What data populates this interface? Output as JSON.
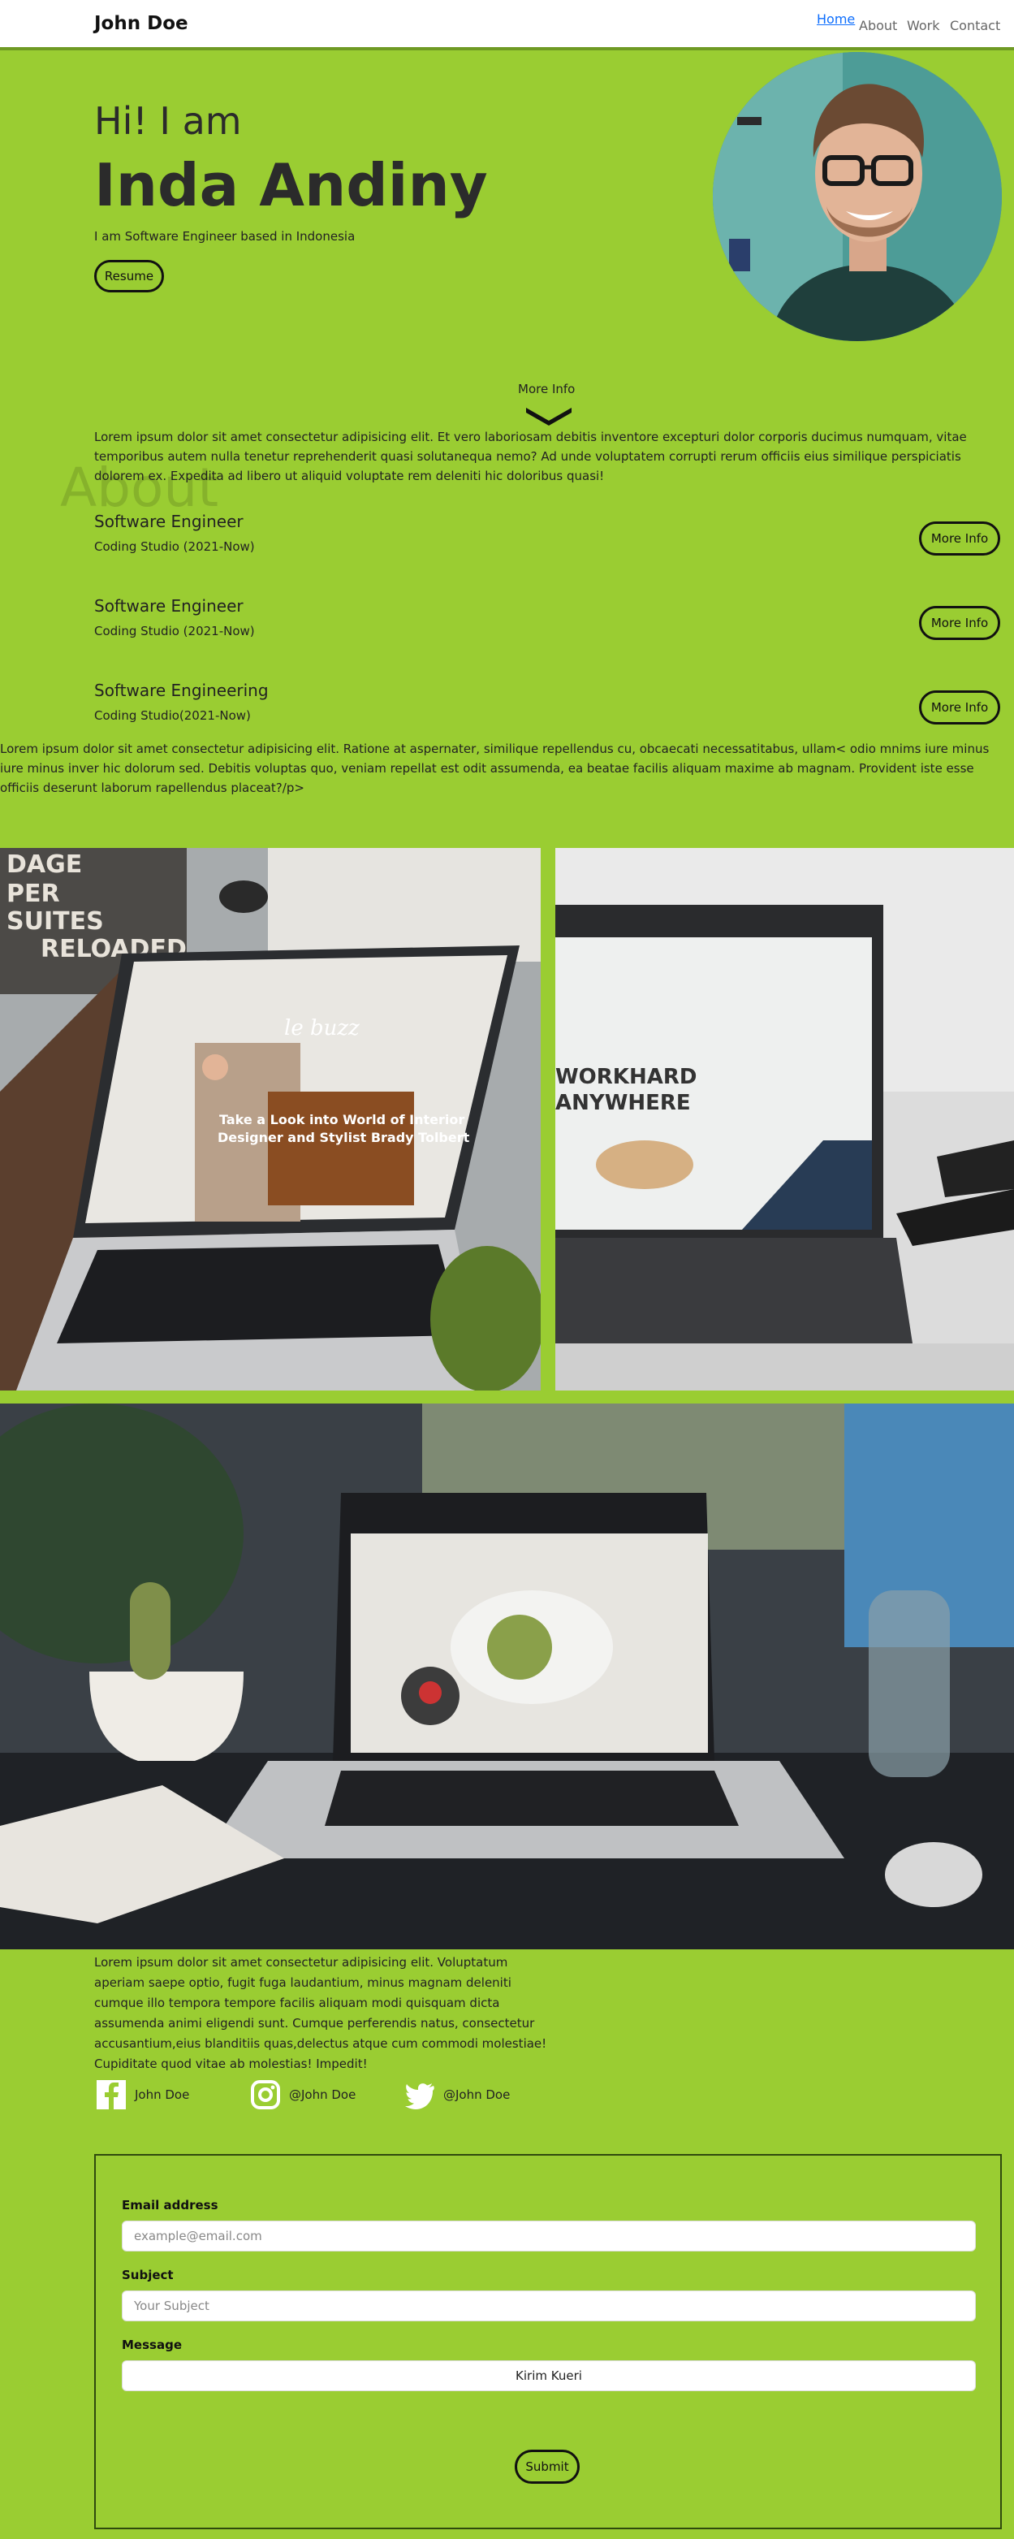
{
  "nav": {
    "brand": "John Doe",
    "links": [
      "Home",
      "About",
      "Work",
      "Contact"
    ]
  },
  "hero": {
    "greeting": "Hi! I am",
    "name": "Inda Andiny",
    "subtitle": "I am Software Engineer based in Indonesia",
    "resume_label": "Resume"
  },
  "about": {
    "more_info": "More Info",
    "watermark": "About",
    "paragraph": "Lorem ipsum dolor sit amet consectetur adipisicing elit. Et vero laboriosam debitis inventore excepturi dolor corporis ducimus numquam, vitae temporibus autem nulla tenetur reprehenderit quasi solutanequa nemo? Ad unde voluptatem corrupti rerum officiis eius similique perspiciatis dolorem ex. Expedita ad libero ut aliquid voluptate rem deleniti hic doloribus quasi!",
    "jobs": [
      {
        "title": "Software Engineer",
        "period": "Coding Studio (2021-Now)",
        "button": "More Info"
      },
      {
        "title": "Software Engineer",
        "period": "Coding Studio (2021-Now)",
        "button": "More Info"
      },
      {
        "title": "Software Engineering",
        "period": "Coding Studio(2021-Now)",
        "button": "More Info"
      }
    ]
  },
  "work": {
    "paragraph": "Lorem ipsum dolor sit amet consectetur adipisicing elit. Ratione at aspernater, similique repellendus cu, obcaecati necessatitabus, ullam< odio mnims iure minus iure minus inver hic dolorum sed. Debitis voluptas quo, veniam repellat est odit assumenda, ea beatae facilis aliquam maxime ab magnam. Provident iste esse officiis deserunt laborum rapellendus placeat?/p>",
    "photo1_screen_text": "Take a Look into World of Interior Designer and Stylist Brady Tolbert",
    "photo1_logo": "le buzz",
    "photo1_sign": "DAGE\nPER\nSUITES\nRELOADED",
    "photo2_screen_text": "WORKHARD\nANYWHERE"
  },
  "contact": {
    "paragraph": "Lorem ipsum dolor sit amet consectetur adipisicing elit. Voluptatum aperiam saepe optio, fugit fuga laudantium, minus magnam deleniti cumque illo tempora tempore facilis aliquam modi quisquam dicta assumenda animi eligendi sunt. Cumque perferendis natus, consectetur accusantium,eius blanditiis quas,delectus atque cum commodi molestiae! Cupiditate quod vitae ab molestias! Impedit!",
    "socials": [
      {
        "icon": "facebook-icon",
        "handle": "John Doe"
      },
      {
        "icon": "instagram-icon",
        "handle": "@John Doe"
      },
      {
        "icon": "twitter-icon",
        "handle": "@John Doe"
      }
    ],
    "form": {
      "email_label": "Email address",
      "email_placeholder": "example@email.com",
      "subject_label": "Subject",
      "subject_placeholder": "Your Subject",
      "message_label": "Message",
      "message_button": "Kirim Kueri",
      "submit_label": "Submit"
    }
  },
  "colors": {
    "background": "#9acd32",
    "nav_active": "#0d6efd",
    "text": "#222222"
  }
}
